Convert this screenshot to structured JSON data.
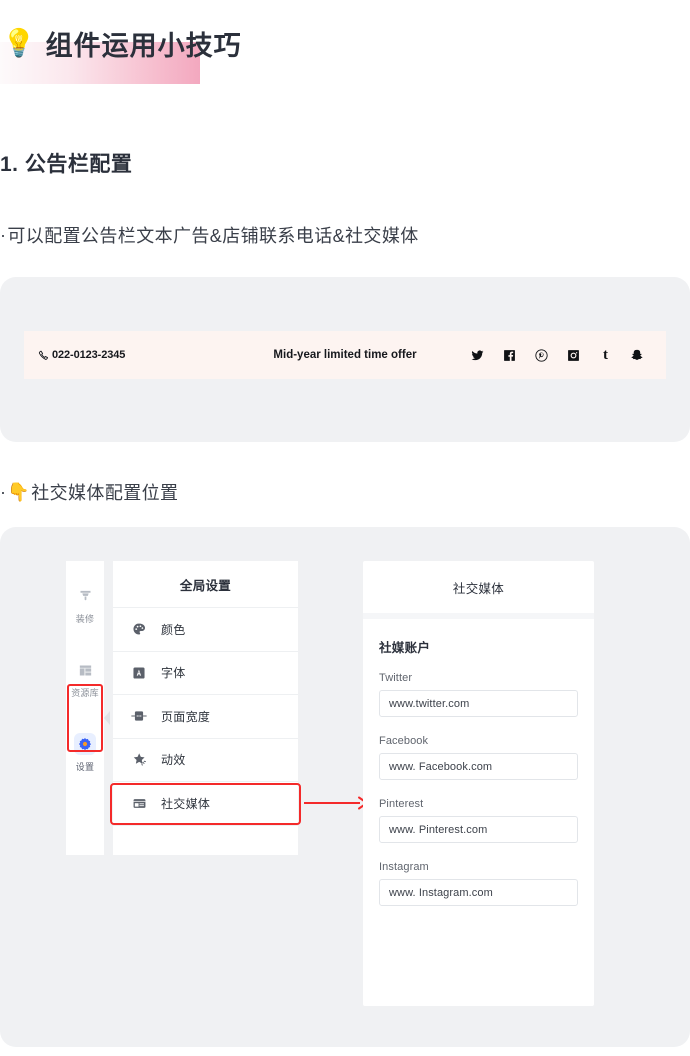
{
  "page": {
    "title": "组件运用小技巧",
    "title_icon": "lightbulb-icon",
    "section_heading": "1. 公告栏配置",
    "bullets": [
      {
        "dot": "·",
        "text": "可以配置公告栏文本广告&店铺联系电话&社交媒体"
      },
      {
        "dot": "·",
        "emoji": "👇",
        "text": "社交媒体配置位置"
      }
    ],
    "highlight_color": "#f3a8bf",
    "accent_red": "#f42a2a",
    "accent_blue": "#3b63f6"
  },
  "announcement_bar": {
    "phone_icon": "phone-icon",
    "phone": "022-0123-2345",
    "message": "Mid-year limited time offer",
    "background": "#fdf4f1",
    "socials": [
      {
        "name": "twitter-icon",
        "label": "Twitter"
      },
      {
        "name": "facebook-icon",
        "label": "Facebook"
      },
      {
        "name": "pinterest-icon",
        "label": "Pinterest"
      },
      {
        "name": "instagram-icon",
        "label": "Instagram"
      },
      {
        "name": "tumblr-icon",
        "label": "Tumblr",
        "glyph": "t"
      },
      {
        "name": "snapchat-icon",
        "label": "Snapchat"
      }
    ]
  },
  "editor": {
    "rail": [
      {
        "icon": "brush-icon",
        "label": "装修",
        "active": false
      },
      {
        "icon": "library-icon",
        "label": "资源库",
        "active": false
      },
      {
        "icon": "gear-icon",
        "label": "设置",
        "active": true
      }
    ],
    "menu": {
      "title": "全局设置",
      "items": [
        {
          "icon": "palette-icon",
          "label": "颜色"
        },
        {
          "icon": "font-icon",
          "label": "字体"
        },
        {
          "icon": "page-width-icon",
          "label": "页面宽度"
        },
        {
          "icon": "animation-icon",
          "label": "动效"
        },
        {
          "icon": "social-media-icon",
          "label": "社交媒体"
        }
      ]
    },
    "panel": {
      "title": "社交媒体",
      "section_title": "社媒账户",
      "fields": [
        {
          "label": "Twitter",
          "value": "www.twitter.com"
        },
        {
          "label": "Facebook",
          "value": "www. Facebook.com"
        },
        {
          "label": "Pinterest",
          "value": "www. Pinterest.com"
        },
        {
          "label": "Instagram",
          "value": "www. Instagram.com"
        }
      ]
    }
  }
}
